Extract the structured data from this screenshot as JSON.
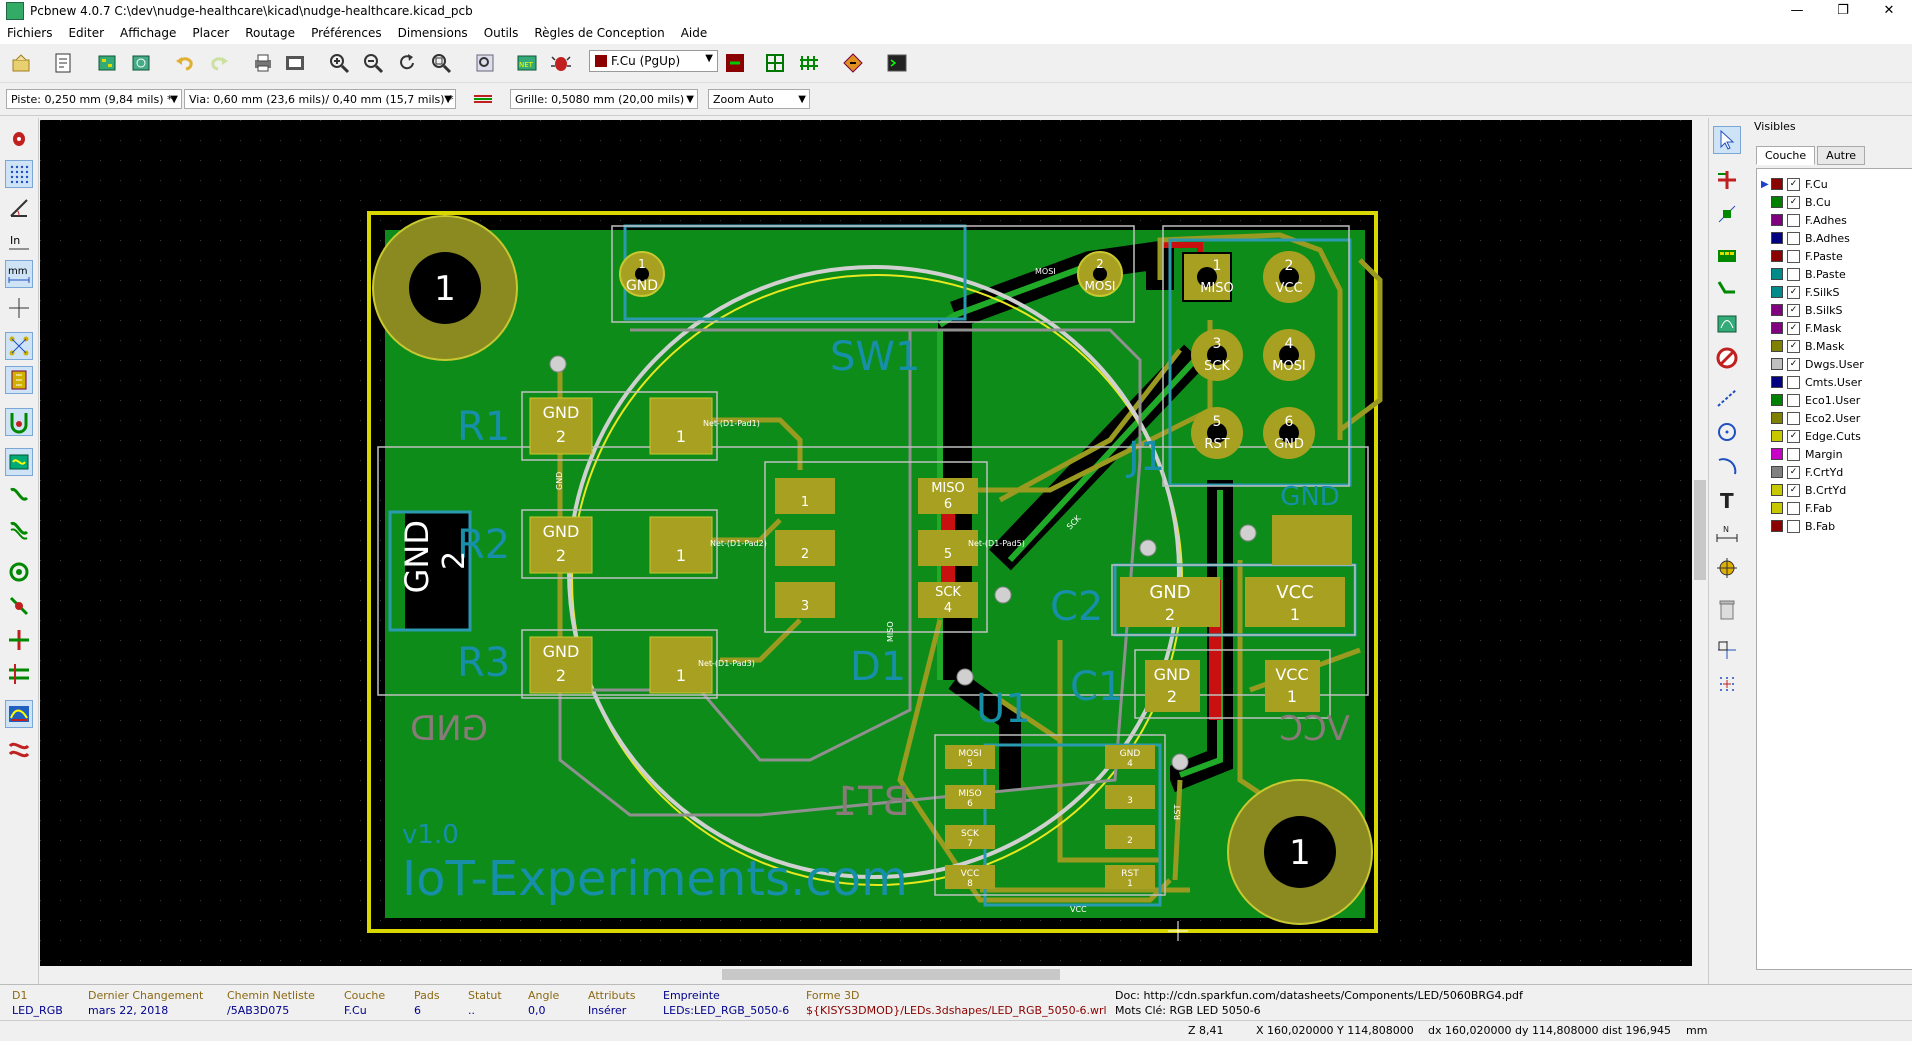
{
  "window": {
    "title": "Pcbnew 4.0.7 C:\\dev\\nudge-healthcare\\kicad\\nudge-healthcare.kicad_pcb",
    "controls": [
      "—",
      "❐",
      "✕"
    ]
  },
  "menu": [
    "Fichiers",
    "Editer",
    "Affichage",
    "Placer",
    "Routage",
    "Préférences",
    "Dimensions",
    "Outils",
    "Règles de Conception",
    "Aide"
  ],
  "toolbar": {
    "active_layer": "F.Cu (PgUp)"
  },
  "aux_toolbar": {
    "track": "Piste: 0,250 mm (9,84 mils) *",
    "via": "Via: 0,60 mm (23,6 mils)/ 0,40 mm (15,7 mils) *",
    "grid": "Grille: 0,5080 mm (20,00 mils)",
    "zoom": "Zoom Auto"
  },
  "left_toolbar_icons": [
    "drc-icon",
    "grid-toggle-icon",
    "polar-coords-icon",
    "inch-units-icon",
    "mm-units-icon",
    "cursor-shape-icon",
    "ratsnest-icon",
    "module-ratsnest-icon",
    "auto-delete-track-icon",
    "zone-fill-icon",
    "zone-outline-icon",
    "zone-nofill-icon",
    "pad-sketch-icon",
    "via-sketch-icon",
    "track-sketch-icon",
    "contrast-icon",
    "microwave-icon",
    "layers-manager-icon"
  ],
  "right_toolbar_icons": [
    "select-arrow-icon",
    "highlight-net-icon",
    "local-ratsnest-icon",
    "add-footprint-icon",
    "route-track-icon",
    "add-zone-icon",
    "keepout-icon",
    "add-line-icon",
    "add-circle-icon",
    "add-arc-icon",
    "add-text-icon",
    "add-dimension-icon",
    "add-target-icon",
    "delete-icon",
    "set-origin-icon",
    "grid-origin-icon"
  ],
  "layers_panel": {
    "header": "Visibles",
    "tabs": [
      "Couche",
      "Autre"
    ],
    "selected_layer": "F.Cu",
    "items": [
      {
        "name": "F.Cu",
        "color": "#8b0000",
        "checked": true
      },
      {
        "name": "B.Cu",
        "color": "#008000",
        "checked": true
      },
      {
        "name": "F.Adhes",
        "color": "#800080",
        "checked": false
      },
      {
        "name": "B.Adhes",
        "color": "#000080",
        "checked": false
      },
      {
        "name": "F.Paste",
        "color": "#8b0000",
        "checked": false
      },
      {
        "name": "B.Paste",
        "color": "#008b8b",
        "checked": false
      },
      {
        "name": "F.SilkS",
        "color": "#008b8b",
        "checked": true
      },
      {
        "name": "B.SilkS",
        "color": "#800080",
        "checked": true
      },
      {
        "name": "F.Mask",
        "color": "#800080",
        "checked": true
      },
      {
        "name": "B.Mask",
        "color": "#808000",
        "checked": true
      },
      {
        "name": "Dwgs.User",
        "color": "#c0c0c0",
        "checked": true
      },
      {
        "name": "Cmts.User",
        "color": "#000080",
        "checked": false
      },
      {
        "name": "Eco1.User",
        "color": "#008000",
        "checked": false
      },
      {
        "name": "Eco2.User",
        "color": "#808000",
        "checked": false
      },
      {
        "name": "Edge.Cuts",
        "color": "#c8c800",
        "checked": true
      },
      {
        "name": "Margin",
        "color": "#c800c8",
        "checked": false
      },
      {
        "name": "F.CrtYd",
        "color": "#808080",
        "checked": true
      },
      {
        "name": "B.CrtYd",
        "color": "#c8c800",
        "checked": true
      },
      {
        "name": "F.Fab",
        "color": "#c8c800",
        "checked": false
      },
      {
        "name": "B.Fab",
        "color": "#8b0000",
        "checked": false
      }
    ]
  },
  "pcb": {
    "silk_front": [
      "SW1",
      "R1",
      "R2",
      "R3",
      "D1",
      "U1",
      "C1",
      "C2",
      "J1",
      "v1.0",
      "IoT-Experiments.com"
    ],
    "silk_back": [
      "BT1",
      "GND",
      "VCC"
    ],
    "mounting_hole_label": "1",
    "pad_labels": {
      "sw_left": "GND",
      "sw_left_num": "1",
      "sw_right": "MOSI",
      "sw_right_num": "2",
      "j1": [
        [
          "1",
          "MISO"
        ],
        [
          "2",
          "VCC"
        ],
        [
          "3",
          "SCK"
        ],
        [
          "4",
          "MOSI"
        ],
        [
          "5",
          "RST"
        ],
        [
          "6",
          "GND"
        ]
      ],
      "j1_gnd": "GND",
      "r_gnd": "GND",
      "r_num_left": "2",
      "r_num_right": "1",
      "d1_left": [
        "1",
        "2",
        "3"
      ],
      "d1_right": [
        [
          "MISO",
          "6"
        ],
        [
          "",
          "5"
        ],
        [
          "SCK",
          "4"
        ]
      ],
      "c2": [
        [
          "GND",
          "2"
        ],
        [
          "VCC",
          "1"
        ]
      ],
      "c1": [
        [
          "GND",
          "2"
        ],
        [
          "VCC",
          "1"
        ]
      ],
      "u1_left": [
        [
          "MOSI",
          "5"
        ],
        [
          "MISO",
          "6"
        ],
        [
          "SCK",
          "7"
        ],
        [
          "VCC",
          "8"
        ]
      ],
      "u1_right": [
        [
          "GND",
          "4"
        ],
        [
          "",
          "3"
        ],
        [
          "",
          "2"
        ],
        [
          "RST",
          "1"
        ]
      ],
      "batt_gnd": "GND",
      "batt_num": "2"
    },
    "net_labels": [
      "Net-(D1-Pad1)",
      "Net-(D1-Pad2)",
      "Net-(D1-Pad3)",
      "Net-(D1-Pad5)",
      "MOSI",
      "MISO",
      "SCK",
      "RST",
      "VCC",
      "GND"
    ]
  },
  "message_panel": [
    {
      "key": "D1",
      "value": "LED_RGB"
    },
    {
      "key": "Dernier Changement",
      "value": "mars 22, 2018"
    },
    {
      "key": "Chemin Netliste",
      "value": "/5AB3D075"
    },
    {
      "key": "Couche",
      "value": "F.Cu"
    },
    {
      "key": "Pads",
      "value": "6"
    },
    {
      "key": "Statut",
      "value": ".."
    },
    {
      "key": "Angle",
      "value": "0,0"
    },
    {
      "key": "Attributs",
      "value": "Insérer"
    },
    {
      "key": "Empreinte",
      "value": "LEDs:LED_RGB_5050-6"
    },
    {
      "key": "Forme 3D",
      "value": "${KISYS3DMOD}/LEDs.3dshapes/LED_RGB_5050-6.wrl"
    },
    {
      "key": "Doc: http://cdn.sparkfun.com/datasheets/Components/LED/5060BRG4.pdf",
      "value": "Mots Clé: RGB LED 5050-6"
    }
  ],
  "status": {
    "zoom": "Z 8,41",
    "abs": "X 160,020000  Y 114,808000",
    "rel": "dx 160,020000  dy 114,808000  dist 196,945",
    "units": "mm"
  }
}
